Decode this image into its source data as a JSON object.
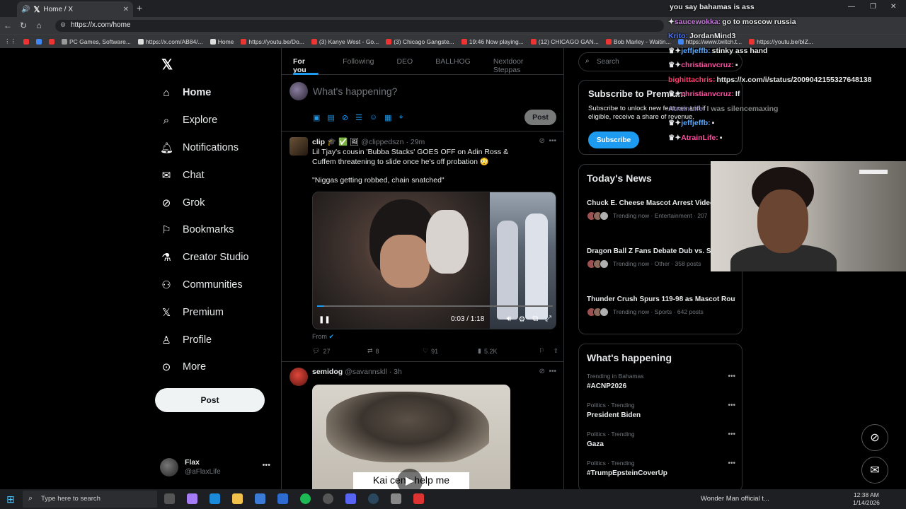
{
  "browser": {
    "tab_title": "Home / X",
    "new_tab": "+",
    "url": "https://x.com/home",
    "bookmarks": [
      "PC Games, Software...",
      "https://x.com/AB84/...",
      "Home",
      "https://youtu.be/Do...",
      "(3) Kanye West - Go...",
      "(3) Chicago Gangste...",
      "19:46 Now playing...",
      "(12) CHICAGO GAN...",
      "Bob Marley - Waitin...",
      "https://www.twitch.t...",
      "https://youtu.be/bIZ..."
    ]
  },
  "left_nav": {
    "items": [
      {
        "label": "Home",
        "icon": "house"
      },
      {
        "label": "Explore",
        "icon": "search"
      },
      {
        "label": "Notifications",
        "icon": "bell"
      },
      {
        "label": "Chat",
        "icon": "envelope"
      },
      {
        "label": "Grok",
        "icon": "grok"
      },
      {
        "label": "Bookmarks",
        "icon": "bookmark"
      },
      {
        "label": "Creator Studio",
        "icon": "flask"
      },
      {
        "label": "Communities",
        "icon": "people"
      },
      {
        "label": "Premium",
        "icon": "x-logo"
      },
      {
        "label": "Profile",
        "icon": "person"
      },
      {
        "label": "More",
        "icon": "more-circle"
      }
    ],
    "post_label": "Post",
    "account": {
      "name": "Flax",
      "handle": "@aFlaxLife"
    }
  },
  "feed": {
    "tabs": [
      "For you",
      "Following",
      "DEO",
      "BALLHOG",
      "Nextdoor Steppas"
    ],
    "compose_placeholder": "What's happening?",
    "compose_post": "Post",
    "tweets": [
      {
        "name": "clip",
        "handle": "@clippedszn",
        "time": "· 29m",
        "text": "Lil Tjay's cousin 'Bubba Stacks' GOES OFF on Adin Ross & Cuffem threatening to slide once he's off probation 😳",
        "quote": "\"Niggas getting robbed, chain snatched\"",
        "video_time": "0:03 / 1:18",
        "video_progress": 0.03,
        "from": "From",
        "replies": "27",
        "reposts": "8",
        "likes": "91",
        "views": "5.2K"
      },
      {
        "name": "semidog",
        "handle": "@savannskll",
        "time": "· 3h",
        "caption": "Kai cena help me"
      }
    ]
  },
  "right": {
    "search_placeholder": "Search",
    "subscribe": {
      "title": "Subscribe to Premium",
      "desc": "Subscribe to unlock new features and if eligible, receive a share of revenue.",
      "button": "Subscribe"
    },
    "news": {
      "title": "Today's News",
      "items": [
        {
          "headline": "Chuck E. Cheese Mascot Arrest Video Resurfaces from 2025 Bust",
          "meta": "Trending now · Entertainment · 207"
        },
        {
          "headline": "Dragon Ball Z Fans Debate Dub vs. Sub Latest Call for Peace",
          "meta": "Trending now · Other · 358 posts"
        },
        {
          "headline": "Thunder Crush Spurs 119-98 as Mascot Routine Clears Up Online Mix-Up",
          "meta": "Trending now · Sports · 642 posts"
        }
      ]
    },
    "happening": {
      "title": "What's happening",
      "items": [
        {
          "context": "Trending in Bahamas",
          "topic": "#ACNP2026"
        },
        {
          "context": "Politics · Trending",
          "topic": "President Biden"
        },
        {
          "context": "Politics · Trending",
          "topic": "Gaza"
        },
        {
          "context": "Politics · Trending",
          "topic": "#TrumpEpsteinCoverUp"
        }
      ]
    }
  },
  "chat_overlay": [
    {
      "user": "",
      "msg": "you say bahamas is ass",
      "color": "#ffffff"
    },
    {
      "user": "saucewokka:",
      "msg": "go to moscow russia",
      "color": "#c678dd"
    },
    {
      "user": "Krito:",
      "msg": "JordanMind3",
      "color": "#4a74ff"
    },
    {
      "user": "jeffjeffb:",
      "msg": "stinky ass hand",
      "color": "#5aa9ff"
    },
    {
      "user": "christianvcruz:",
      "msg": "",
      "color": "#ff4fa0"
    },
    {
      "user": "bighittachris:",
      "msg": "https://x.com/i/status/2009042155327648138",
      "color": "#ff3b6b"
    },
    {
      "user": "christianvcruz:",
      "msg": "If",
      "color": "#ff4fa0"
    },
    {
      "user": "AtrainLife:",
      "msg": "I was silencemaxing",
      "color": "#b9a6ff"
    },
    {
      "user": "jeffjeffb:",
      "msg": "",
      "color": "#5aa9ff"
    },
    {
      "user": "AtrainLife:",
      "msg": "",
      "color": "#ff4fa0"
    }
  ],
  "taskbar": {
    "search_placeholder": "Type here to search",
    "media": "Wonder Man official t...",
    "time": "12:38 AM",
    "date": "1/14/2026"
  }
}
